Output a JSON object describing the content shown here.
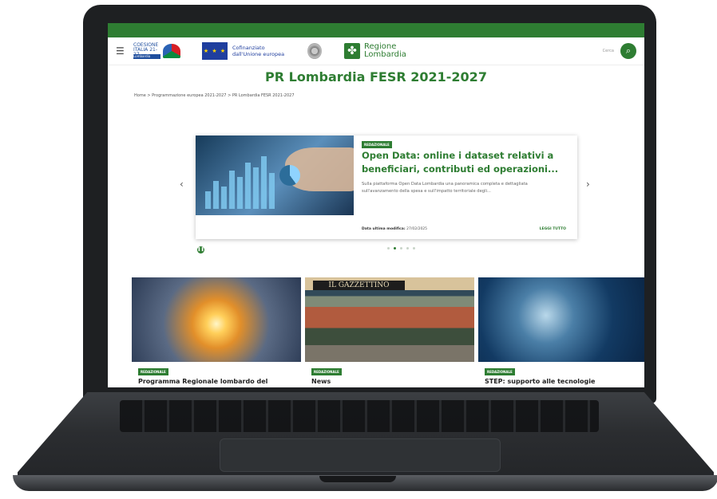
{
  "header": {
    "coesione_logo": "COESIONE ITALIA 21-27",
    "coesione_bar": "Lombardia",
    "eu_flag": "★ ★ ★",
    "eu_text": "Cofinanziato\ndall'Unione europea",
    "region_name": "Regione\nLombardia",
    "search_label": "Cerca"
  },
  "page": {
    "title": "PR Lombardia FESR 2021-2027",
    "breadcrumb": "Home  >  Programmazione europea 2021-2027  >  PR Lombardia FESR 2021-2027"
  },
  "carousel": {
    "badge": "REDAZIONALE",
    "title": "Open Data: online i dataset relativi a beneficiari, contributi ed operazioni...",
    "description": "Sulla piattaforma Open Data Lombardia una panoramica completa e dettagliata sull'avanzamento della spesa e sull'impatto territoriale degli...",
    "date_label": "Data ultima modifica:",
    "date_value": "27/02/2025",
    "more": "LEGGI TUTTO",
    "prev": "‹",
    "next": "›",
    "dots_total": 5,
    "active_dot": 2
  },
  "cards": [
    {
      "badge": "REDAZIONALE",
      "title": "Programma Regionale lombardo del"
    },
    {
      "badge": "REDAZIONALE",
      "title": "News",
      "image_text": "IL GAZZETTINO"
    },
    {
      "badge": "REDAZIONALE",
      "title": "STEP: supporto alle tecnologie"
    }
  ]
}
